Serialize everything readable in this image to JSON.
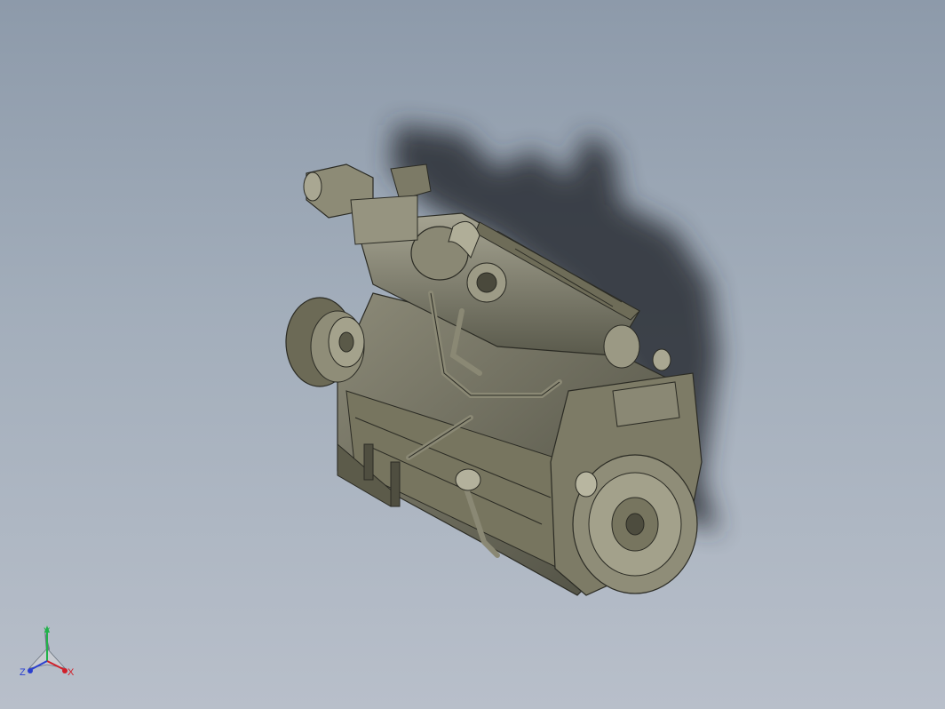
{
  "viewport": {
    "background_top": "#8d9aaa",
    "background_bottom": "#b8bfca",
    "model": "engine-assembly-3d-model",
    "shading": "shaded-with-edges",
    "shadow_visible": true
  },
  "triad": {
    "x_label": "X",
    "y_label": "Y",
    "z_label": "Z",
    "x_color": "#d0202a",
    "y_color": "#22b24a",
    "z_color": "#2a3fcf"
  }
}
